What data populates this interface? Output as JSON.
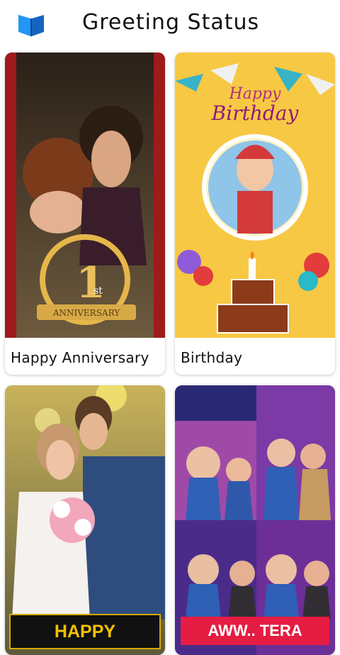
{
  "header": {
    "title": "Greeting Status"
  },
  "cards": [
    {
      "label": "Happy Anniversary"
    },
    {
      "label": "Birthday",
      "art_text_1": "Happy",
      "art_text_2": "Birthday"
    },
    {
      "banner": "HAPPY ANIVERSARY"
    },
    {
      "banner": "AWW.. TERA"
    }
  ],
  "colors": {
    "brand_blue": "#1e88e5",
    "birthday_yellow": "#f7c843",
    "banner_red": "#e51d42"
  },
  "icons": {
    "logo": "book-icon"
  }
}
